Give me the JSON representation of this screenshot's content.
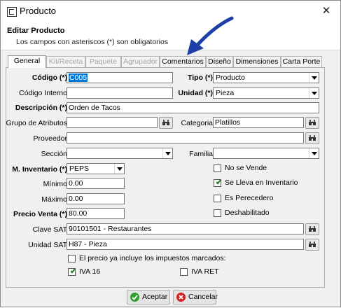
{
  "window": {
    "title": "Producto",
    "close_glyph": "✕"
  },
  "header": {
    "title": "Editar Producto",
    "subtitle": "Los campos con asteriscos (*) son obligatorios"
  },
  "tabs": [
    {
      "label": "General",
      "state": "active"
    },
    {
      "label": "Kit/Receta",
      "state": "disabled"
    },
    {
      "label": "Paquete",
      "state": "disabled"
    },
    {
      "label": "Agrupador",
      "state": "disabled"
    },
    {
      "label": "Comentarios",
      "state": "enabled"
    },
    {
      "label": "Diseño",
      "state": "enabled"
    },
    {
      "label": "Dimensiones",
      "state": "enabled"
    },
    {
      "label": "Carta Porte",
      "state": "enabled"
    }
  ],
  "form": {
    "codigo": {
      "label": "Código (*)",
      "value": "C005"
    },
    "tipo": {
      "label": "Tipo (*)",
      "value": "Producto"
    },
    "codigo_interno": {
      "label": "Código Interno",
      "value": ""
    },
    "unidad": {
      "label": "Unidad (*)",
      "value": "Pieza"
    },
    "descripcion": {
      "label": "Descripción (*)",
      "value": "Orden de Tacos"
    },
    "grupo_atributos": {
      "label": "Grupo de Atributos",
      "value": ""
    },
    "categoria": {
      "label": "Categoria",
      "value": "Platillos"
    },
    "proveedor": {
      "label": "Proveedor",
      "value": ""
    },
    "seccion": {
      "label": "Sección",
      "value": ""
    },
    "familia": {
      "label": "Familia",
      "value": ""
    },
    "m_inventario": {
      "label": "M. Inventario (*)",
      "value": "PEPS"
    },
    "minimo": {
      "label": "Mínimo",
      "value": "0.00"
    },
    "maximo": {
      "label": "Máximo",
      "value": "0.00"
    },
    "precio_venta": {
      "label": "Precio Venta (*)",
      "value": "80.00"
    },
    "clave_sat": {
      "label": "Clave SAT",
      "value": "90101501 - Restaurantes"
    },
    "unidad_sat": {
      "label": "Unidad SAT",
      "value": "H87 - Pieza"
    }
  },
  "checks": {
    "no_se_vende": {
      "label": "No se Vende",
      "checked": false
    },
    "se_lleva_inventario": {
      "label": "Se Lleva en Inventario",
      "checked": true
    },
    "es_perecedero": {
      "label": "Es Perecedero",
      "checked": false
    },
    "deshabilitado": {
      "label": "Deshabilitado",
      "checked": false
    },
    "precio_incluye": {
      "label": "El precio ya incluye los impuestos marcados:",
      "checked": false
    },
    "iva16": {
      "label": "IVA 16",
      "checked": true
    },
    "iva_ret": {
      "label": "IVA RET",
      "checked": false
    }
  },
  "buttons": {
    "accept": "Aceptar",
    "cancel": "Cancelar"
  },
  "colors": {
    "accent": "#0078d7",
    "arrow": "#1f3fa8",
    "accept_icon": "#2e9e2e",
    "cancel_icon": "#d42020"
  },
  "icons": {
    "lookup": "binoculars-icon",
    "check": "checkmark-icon"
  }
}
